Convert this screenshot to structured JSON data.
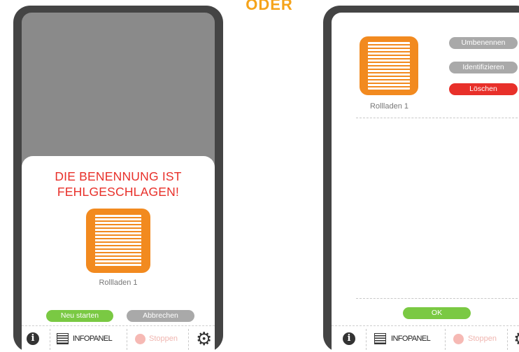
{
  "separator_text": "ODER",
  "left_phone": {
    "dialog": {
      "title_line1": "DIE BENENNUNG IST",
      "title_line2": "FEHLGESCHLAGEN!",
      "device_name": "Rollladen 1",
      "restart_label": "Neu starten",
      "cancel_label": "Abbrechen"
    },
    "bottom_bar": {
      "infopanel_label": "INFOPANEL",
      "stop_label": "Stoppen"
    }
  },
  "right_phone": {
    "device_name": "Rollladen 1",
    "rename_label": "Umbenennen",
    "identify_label": "Identifizieren",
    "delete_label": "Löschen",
    "ok_label": "OK",
    "bottom_bar": {
      "infopanel_label": "INFOPANEL",
      "stop_label": "Stoppen"
    }
  },
  "colors": {
    "accent_orange": "#f28a1f",
    "error_red": "#e8302a",
    "confirm_green": "#7ac943",
    "neutral_gray": "#a9a9a9",
    "heading_yellow": "#f5a31a"
  }
}
